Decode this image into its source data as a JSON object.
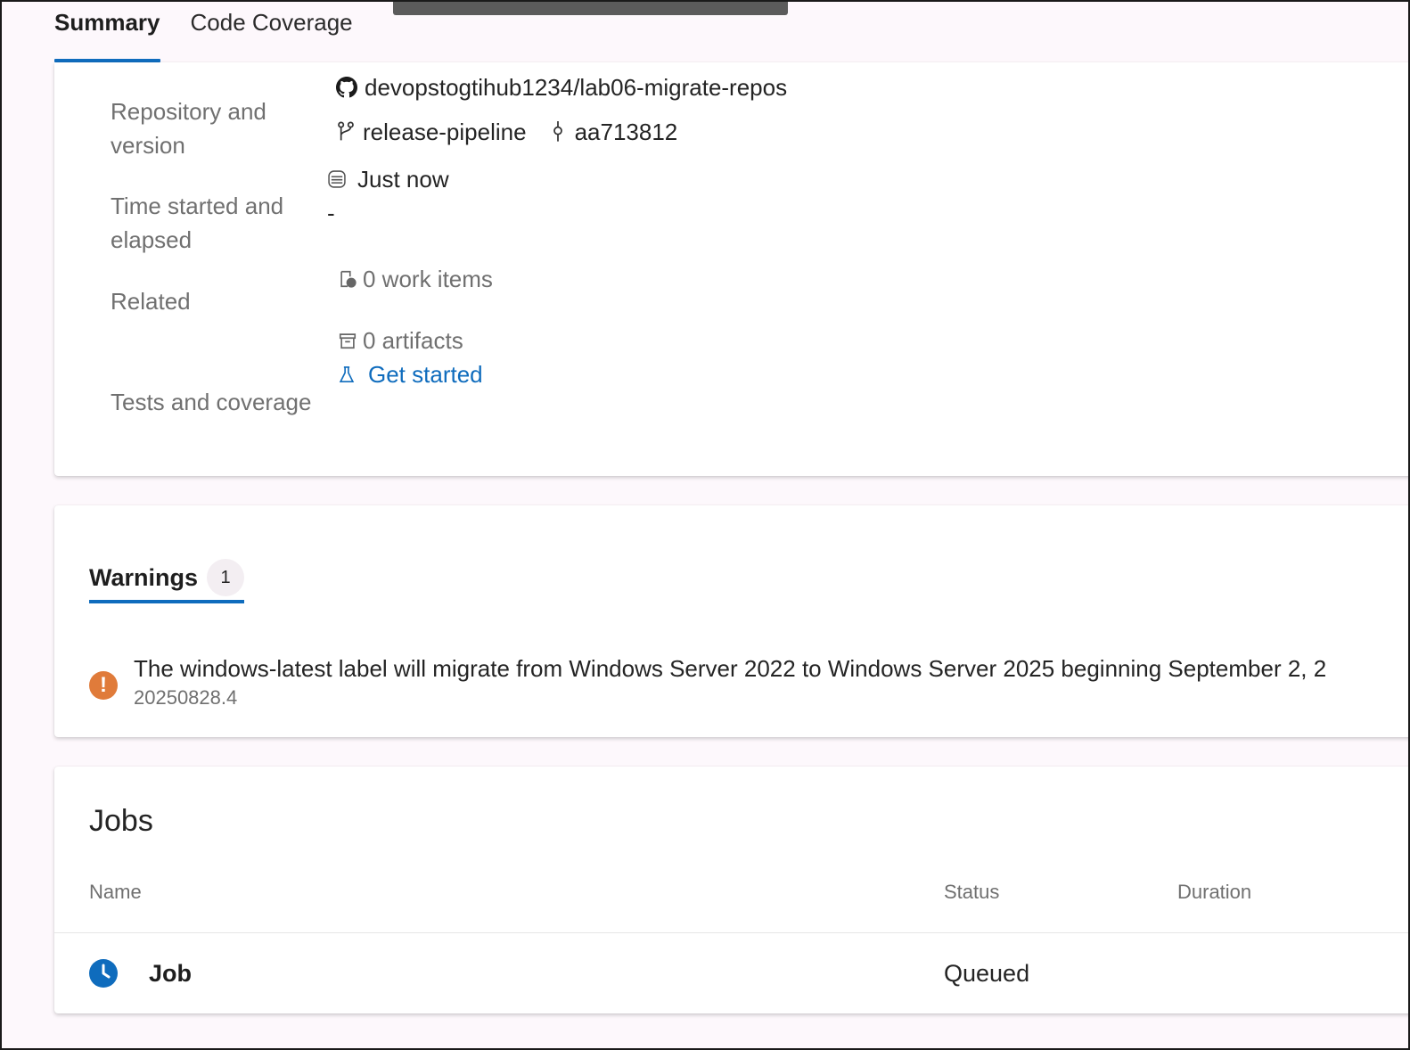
{
  "tabs": {
    "summary": "Summary",
    "code_coverage": "Code Coverage"
  },
  "summary": {
    "repository_label": "Repository and version",
    "repository": "devopstogtihub1234/lab06-migrate-repos",
    "branch": "release-pipeline",
    "commit": "aa713812",
    "time_label": "Time started and elapsed",
    "time_started": "Just now",
    "time_elapsed": "-",
    "related_label": "Related",
    "work_items": "0 work items",
    "artifacts": "0 artifacts",
    "tests_label": "Tests and coverage",
    "tests_link": "Get started"
  },
  "warnings": {
    "tab_label": "Warnings",
    "count": "1",
    "message": "The windows-latest label will migrate from Windows Server 2022 to Windows Server 2025 beginning September 2, 2",
    "sub": "20250828.4",
    "icon": "warning-icon",
    "color": "#e07b3a"
  },
  "jobs": {
    "title": "Jobs",
    "columns": {
      "name": "Name",
      "status": "Status",
      "duration": "Duration"
    },
    "rows": [
      {
        "name": "Job",
        "status": "Queued",
        "icon": "clock-icon"
      }
    ]
  },
  "colors": {
    "accent": "#0f6cbd",
    "warning": "#e07b3a",
    "queued": "#0f6cbd"
  }
}
